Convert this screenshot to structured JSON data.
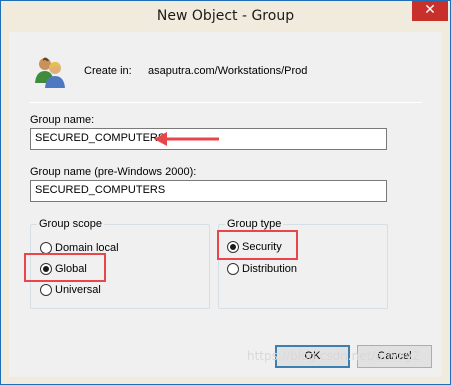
{
  "window": {
    "title": "New Object - Group",
    "close_glyph": "✕"
  },
  "create_in": {
    "label": "Create in:",
    "path": "asaputra.com/Workstations/Prod"
  },
  "group_name": {
    "label": "Group name:",
    "value": "SECURED_COMPUTERS"
  },
  "group_name_pre2000": {
    "label": "Group name (pre-Windows 2000):",
    "value": "SECURED_COMPUTERS"
  },
  "group_scope": {
    "title": "Group scope",
    "options": [
      {
        "label": "Domain local",
        "checked": false
      },
      {
        "label": "Global",
        "checked": true
      },
      {
        "label": "Universal",
        "checked": false
      }
    ]
  },
  "group_type": {
    "title": "Group type",
    "options": [
      {
        "label": "Security",
        "checked": true
      },
      {
        "label": "Distribution",
        "checked": false
      }
    ]
  },
  "buttons": {
    "ok": "OK",
    "cancel": "Cancel"
  },
  "watermark": "https://blog.csdn.net/ativay2",
  "colors": {
    "highlight": "#e8464a",
    "close_button": "#c7302b",
    "window_border": "#1e6fb8"
  },
  "icons": {
    "header": "users-group-icon",
    "annotation": "red-arrow-icon"
  }
}
